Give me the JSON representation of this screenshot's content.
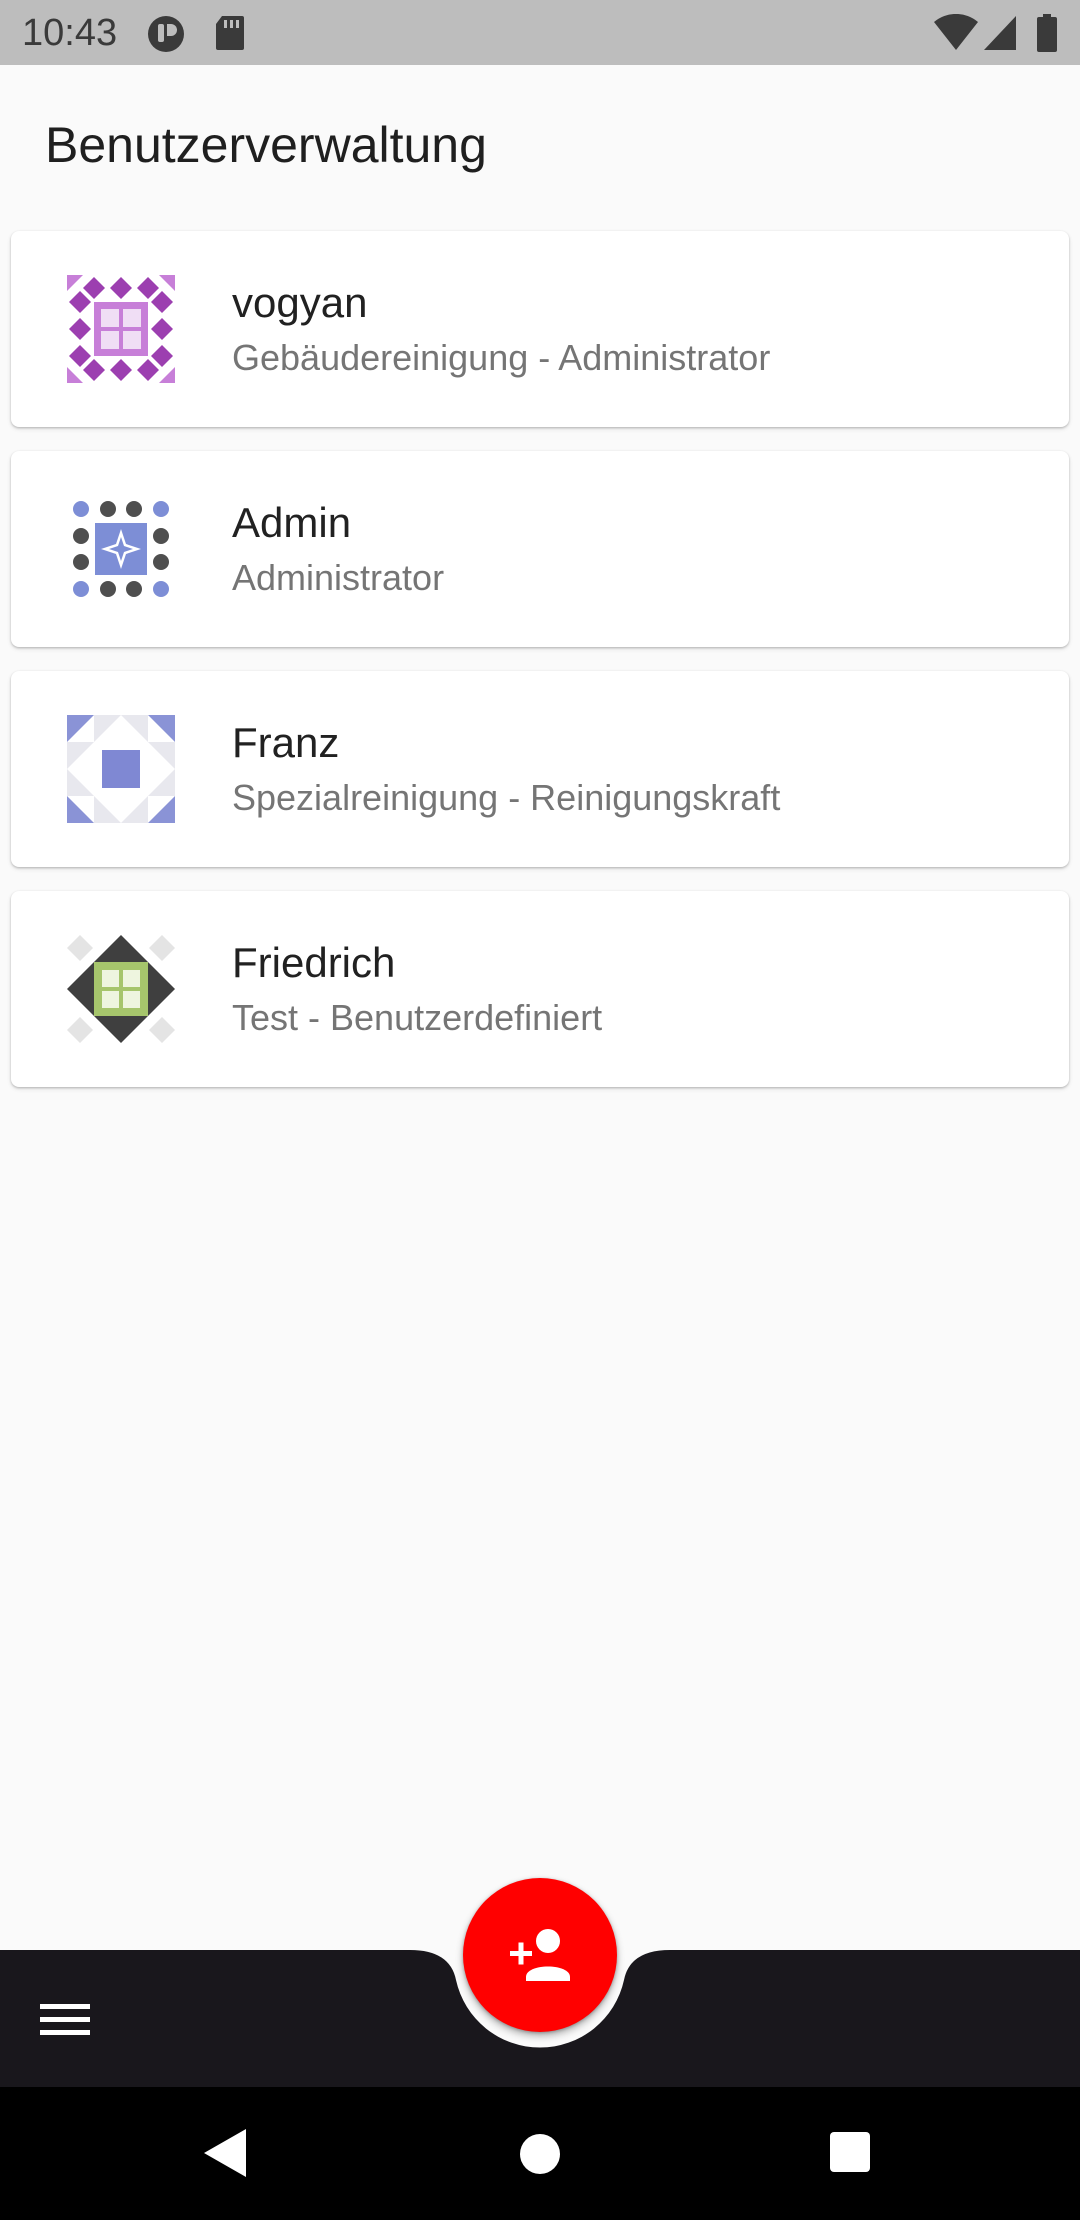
{
  "status_bar": {
    "time": "10:43",
    "icons": [
      "privacy-indicator-icon",
      "sd-card-icon",
      "wifi-icon",
      "cell-signal-icon",
      "battery-icon"
    ]
  },
  "header": {
    "title": "Benutzerverwaltung"
  },
  "users": [
    {
      "name": "vogyan",
      "role": "Gebäudereinigung - Administrator",
      "avatar": "identicon-purple-icon",
      "avatar_color": "#9c3fb0"
    },
    {
      "name": "Admin",
      "role": "Administrator",
      "avatar": "identicon-blue-dots-icon",
      "avatar_color": "#7d8ed6"
    },
    {
      "name": "Franz",
      "role": "Spezialreinigung - Reinigungskraft",
      "avatar": "identicon-blue-square-icon",
      "avatar_color": "#7f88d3"
    },
    {
      "name": "Friedrich",
      "role": "Test - Benutzerdefiniert",
      "avatar": "identicon-green-diamond-icon",
      "avatar_color": "#a6c56c"
    }
  ],
  "bottom_bar": {
    "menu_icon": "hamburger-menu-icon",
    "fab_icon": "add-person-icon",
    "fab_color": "#ff0000",
    "bar_color": "#19171c"
  },
  "nav_bar": {
    "icons": [
      "back-icon",
      "home-icon",
      "recents-icon"
    ]
  }
}
